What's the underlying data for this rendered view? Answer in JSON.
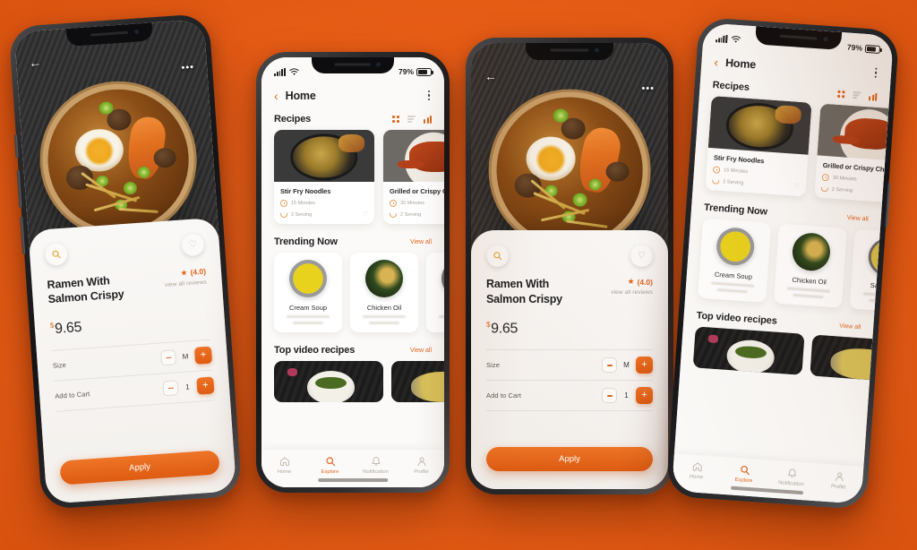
{
  "background": {
    "color": "#E85E17"
  },
  "theme": {
    "accent": "#E2661E",
    "accent_dark": "#DE5B12",
    "text": "#1F1F22",
    "muted": "#A9A29B"
  },
  "status_bar": {
    "battery_percent": "79%",
    "battery_level": 79
  },
  "detail_screen": {
    "back_icon": "←",
    "more_icon": "•••",
    "search_icon": "search-icon",
    "favorite_icon": "♡",
    "product_title_line1": "Ramen With",
    "product_title_line2": "Salmon Crispy",
    "rating_star": "★",
    "rating_value": "(4.0)",
    "reviews_link": "view all reviews",
    "currency": "$",
    "price": "9.65",
    "options": [
      {
        "label": "Size",
        "value": "M",
        "minus": "−",
        "plus": "+"
      },
      {
        "label": "Add to Cart",
        "value": "1",
        "minus": "−",
        "plus": "+"
      }
    ],
    "apply_label": "Apply"
  },
  "home_screen": {
    "back_icon": "‹",
    "title": "Home",
    "menu_icon": "kebab-menu-icon",
    "recipes": {
      "title": "Recipes",
      "toggles": [
        "grid-view-icon",
        "list-view-icon",
        "sort-icon"
      ],
      "cards": [
        {
          "title": "Stir Fry Noodles",
          "time": "15 Minutes",
          "serving": "2 Serving"
        },
        {
          "title": "Grilled or Crispy Ch",
          "time": "30 Minutes",
          "serving": "2 Serving"
        }
      ]
    },
    "trending": {
      "title": "Trending Now",
      "view_all": "View all",
      "items": [
        {
          "name": "Cream Soup"
        },
        {
          "name": "Chicken Oil"
        },
        {
          "name": "Salad Mie"
        }
      ]
    },
    "videos": {
      "title": "Top video recipes",
      "view_all": "View all"
    },
    "tabs": [
      {
        "label": "Home",
        "icon": "home-icon",
        "active": false
      },
      {
        "label": "Explore",
        "icon": "search-icon",
        "active": true
      },
      {
        "label": "Notification",
        "icon": "bell-icon",
        "active": false
      },
      {
        "label": "Profile",
        "icon": "person-icon",
        "active": false
      }
    ]
  }
}
